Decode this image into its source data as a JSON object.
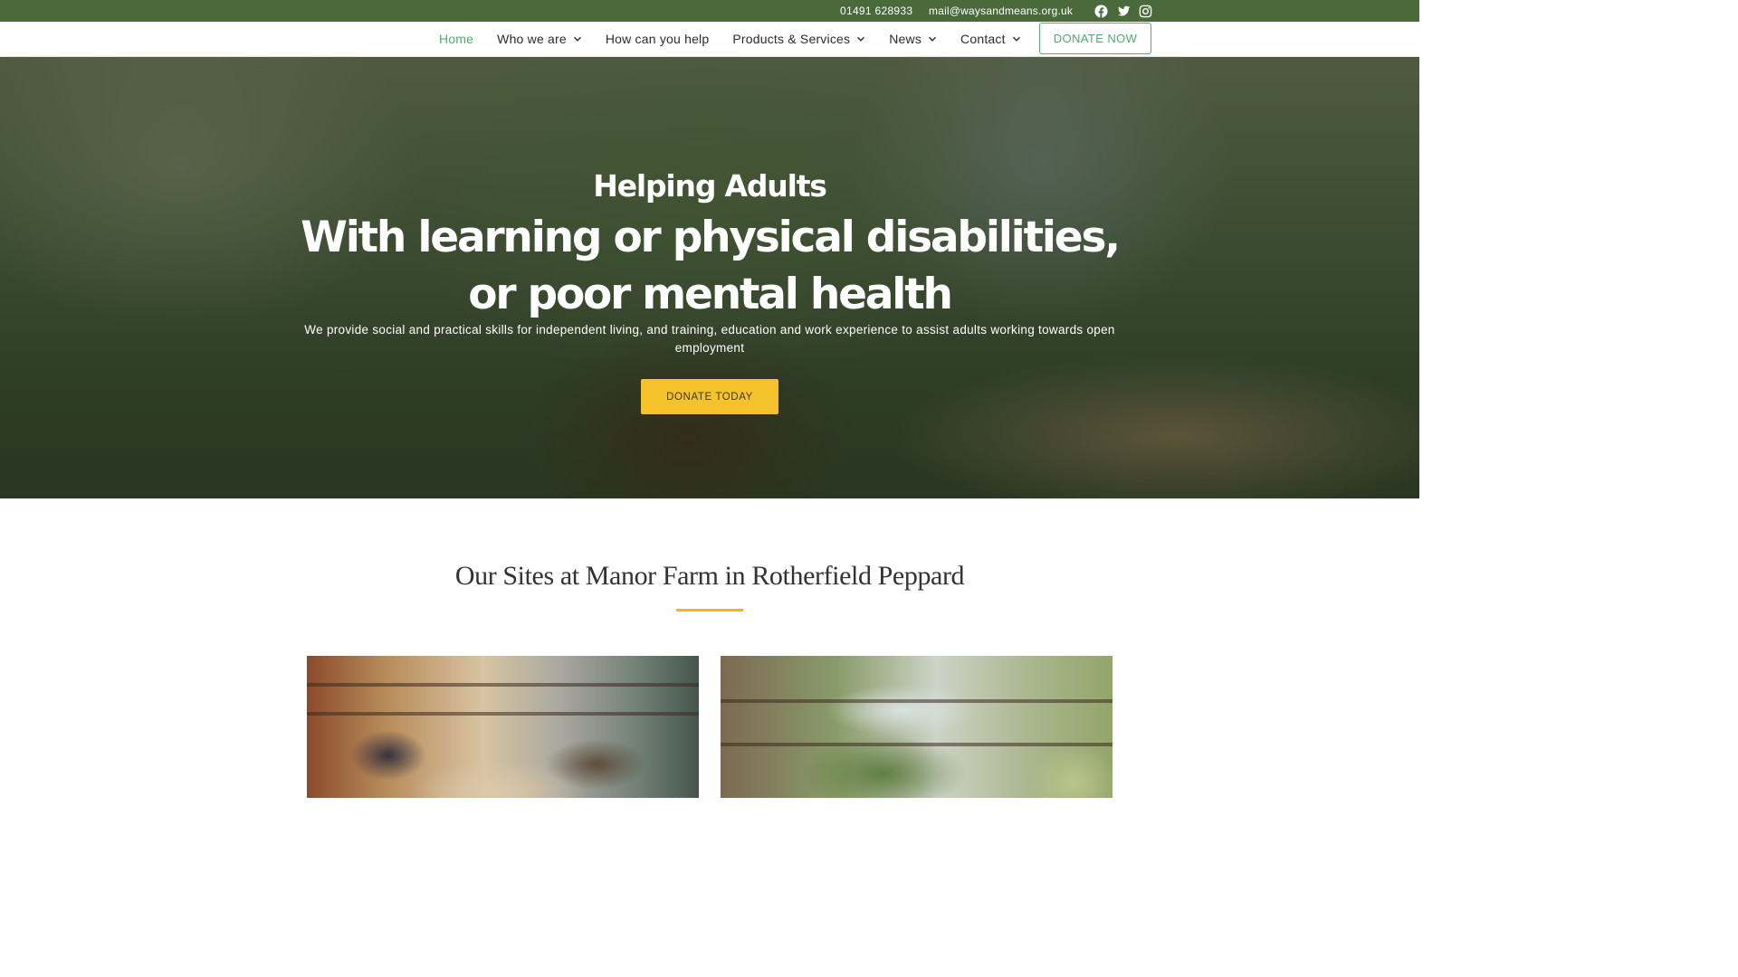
{
  "topbar": {
    "phone": "01491 628933",
    "email": "mail@waysandmeans.org.uk",
    "social": [
      "facebook-icon",
      "twitter-icon",
      "instagram-icon"
    ]
  },
  "nav": {
    "items": [
      {
        "label": "Home",
        "active": true,
        "dropdown": false
      },
      {
        "label": "Who we are",
        "active": false,
        "dropdown": true
      },
      {
        "label": "How can you help",
        "active": false,
        "dropdown": false
      },
      {
        "label": "Products & Services",
        "active": false,
        "dropdown": true
      },
      {
        "label": "News",
        "active": false,
        "dropdown": true
      },
      {
        "label": "Contact",
        "active": false,
        "dropdown": true
      }
    ],
    "donate_label": "DONATE NOW"
  },
  "hero": {
    "kicker": "Helping Adults",
    "title": "With learning or physical disabilities, or poor mental health",
    "description": "We provide social and practical skills for independent living, and training, education and work experience to assist adults working towards open employment",
    "button_label": "DONATE TODAY"
  },
  "sites": {
    "heading": "Our Sites at Manor Farm in Rotherfield Peppard"
  },
  "colors": {
    "topbar": "#4a6a3c",
    "accent_green": "#4caf6f",
    "accent_yellow": "#f6c22b",
    "divider_gold": "#f2b51f"
  }
}
